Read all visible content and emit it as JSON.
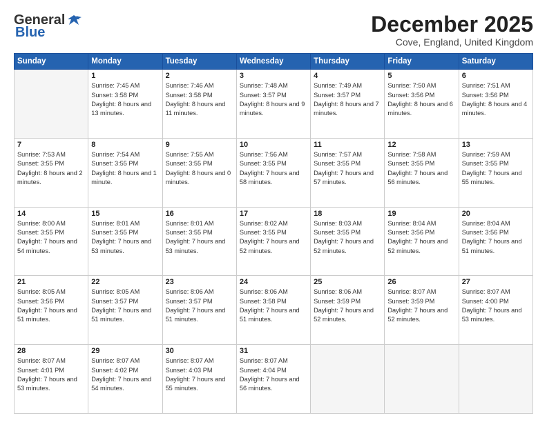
{
  "header": {
    "logo_general": "General",
    "logo_blue": "Blue",
    "month_title": "December 2025",
    "location": "Cove, England, United Kingdom"
  },
  "weekdays": [
    "Sunday",
    "Monday",
    "Tuesday",
    "Wednesday",
    "Thursday",
    "Friday",
    "Saturday"
  ],
  "weeks": [
    [
      {
        "day": "",
        "sunrise": "",
        "sunset": "",
        "daylight": "",
        "empty": true
      },
      {
        "day": "1",
        "sunrise": "Sunrise: 7:45 AM",
        "sunset": "Sunset: 3:58 PM",
        "daylight": "Daylight: 8 hours and 13 minutes."
      },
      {
        "day": "2",
        "sunrise": "Sunrise: 7:46 AM",
        "sunset": "Sunset: 3:58 PM",
        "daylight": "Daylight: 8 hours and 11 minutes."
      },
      {
        "day": "3",
        "sunrise": "Sunrise: 7:48 AM",
        "sunset": "Sunset: 3:57 PM",
        "daylight": "Daylight: 8 hours and 9 minutes."
      },
      {
        "day": "4",
        "sunrise": "Sunrise: 7:49 AM",
        "sunset": "Sunset: 3:57 PM",
        "daylight": "Daylight: 8 hours and 7 minutes."
      },
      {
        "day": "5",
        "sunrise": "Sunrise: 7:50 AM",
        "sunset": "Sunset: 3:56 PM",
        "daylight": "Daylight: 8 hours and 6 minutes."
      },
      {
        "day": "6",
        "sunrise": "Sunrise: 7:51 AM",
        "sunset": "Sunset: 3:56 PM",
        "daylight": "Daylight: 8 hours and 4 minutes."
      }
    ],
    [
      {
        "day": "7",
        "sunrise": "Sunrise: 7:53 AM",
        "sunset": "Sunset: 3:55 PM",
        "daylight": "Daylight: 8 hours and 2 minutes."
      },
      {
        "day": "8",
        "sunrise": "Sunrise: 7:54 AM",
        "sunset": "Sunset: 3:55 PM",
        "daylight": "Daylight: 8 hours and 1 minute."
      },
      {
        "day": "9",
        "sunrise": "Sunrise: 7:55 AM",
        "sunset": "Sunset: 3:55 PM",
        "daylight": "Daylight: 8 hours and 0 minutes."
      },
      {
        "day": "10",
        "sunrise": "Sunrise: 7:56 AM",
        "sunset": "Sunset: 3:55 PM",
        "daylight": "Daylight: 7 hours and 58 minutes."
      },
      {
        "day": "11",
        "sunrise": "Sunrise: 7:57 AM",
        "sunset": "Sunset: 3:55 PM",
        "daylight": "Daylight: 7 hours and 57 minutes."
      },
      {
        "day": "12",
        "sunrise": "Sunrise: 7:58 AM",
        "sunset": "Sunset: 3:55 PM",
        "daylight": "Daylight: 7 hours and 56 minutes."
      },
      {
        "day": "13",
        "sunrise": "Sunrise: 7:59 AM",
        "sunset": "Sunset: 3:55 PM",
        "daylight": "Daylight: 7 hours and 55 minutes."
      }
    ],
    [
      {
        "day": "14",
        "sunrise": "Sunrise: 8:00 AM",
        "sunset": "Sunset: 3:55 PM",
        "daylight": "Daylight: 7 hours and 54 minutes."
      },
      {
        "day": "15",
        "sunrise": "Sunrise: 8:01 AM",
        "sunset": "Sunset: 3:55 PM",
        "daylight": "Daylight: 7 hours and 53 minutes."
      },
      {
        "day": "16",
        "sunrise": "Sunrise: 8:01 AM",
        "sunset": "Sunset: 3:55 PM",
        "daylight": "Daylight: 7 hours and 53 minutes."
      },
      {
        "day": "17",
        "sunrise": "Sunrise: 8:02 AM",
        "sunset": "Sunset: 3:55 PM",
        "daylight": "Daylight: 7 hours and 52 minutes."
      },
      {
        "day": "18",
        "sunrise": "Sunrise: 8:03 AM",
        "sunset": "Sunset: 3:55 PM",
        "daylight": "Daylight: 7 hours and 52 minutes."
      },
      {
        "day": "19",
        "sunrise": "Sunrise: 8:04 AM",
        "sunset": "Sunset: 3:56 PM",
        "daylight": "Daylight: 7 hours and 52 minutes."
      },
      {
        "day": "20",
        "sunrise": "Sunrise: 8:04 AM",
        "sunset": "Sunset: 3:56 PM",
        "daylight": "Daylight: 7 hours and 51 minutes."
      }
    ],
    [
      {
        "day": "21",
        "sunrise": "Sunrise: 8:05 AM",
        "sunset": "Sunset: 3:56 PM",
        "daylight": "Daylight: 7 hours and 51 minutes."
      },
      {
        "day": "22",
        "sunrise": "Sunrise: 8:05 AM",
        "sunset": "Sunset: 3:57 PM",
        "daylight": "Daylight: 7 hours and 51 minutes."
      },
      {
        "day": "23",
        "sunrise": "Sunrise: 8:06 AM",
        "sunset": "Sunset: 3:57 PM",
        "daylight": "Daylight: 7 hours and 51 minutes."
      },
      {
        "day": "24",
        "sunrise": "Sunrise: 8:06 AM",
        "sunset": "Sunset: 3:58 PM",
        "daylight": "Daylight: 7 hours and 51 minutes."
      },
      {
        "day": "25",
        "sunrise": "Sunrise: 8:06 AM",
        "sunset": "Sunset: 3:59 PM",
        "daylight": "Daylight: 7 hours and 52 minutes."
      },
      {
        "day": "26",
        "sunrise": "Sunrise: 8:07 AM",
        "sunset": "Sunset: 3:59 PM",
        "daylight": "Daylight: 7 hours and 52 minutes."
      },
      {
        "day": "27",
        "sunrise": "Sunrise: 8:07 AM",
        "sunset": "Sunset: 4:00 PM",
        "daylight": "Daylight: 7 hours and 53 minutes."
      }
    ],
    [
      {
        "day": "28",
        "sunrise": "Sunrise: 8:07 AM",
        "sunset": "Sunset: 4:01 PM",
        "daylight": "Daylight: 7 hours and 53 minutes."
      },
      {
        "day": "29",
        "sunrise": "Sunrise: 8:07 AM",
        "sunset": "Sunset: 4:02 PM",
        "daylight": "Daylight: 7 hours and 54 minutes."
      },
      {
        "day": "30",
        "sunrise": "Sunrise: 8:07 AM",
        "sunset": "Sunset: 4:03 PM",
        "daylight": "Daylight: 7 hours and 55 minutes."
      },
      {
        "day": "31",
        "sunrise": "Sunrise: 8:07 AM",
        "sunset": "Sunset: 4:04 PM",
        "daylight": "Daylight: 7 hours and 56 minutes."
      },
      {
        "day": "",
        "sunrise": "",
        "sunset": "",
        "daylight": "",
        "empty": true
      },
      {
        "day": "",
        "sunrise": "",
        "sunset": "",
        "daylight": "",
        "empty": true
      },
      {
        "day": "",
        "sunrise": "",
        "sunset": "",
        "daylight": "",
        "empty": true
      }
    ]
  ]
}
